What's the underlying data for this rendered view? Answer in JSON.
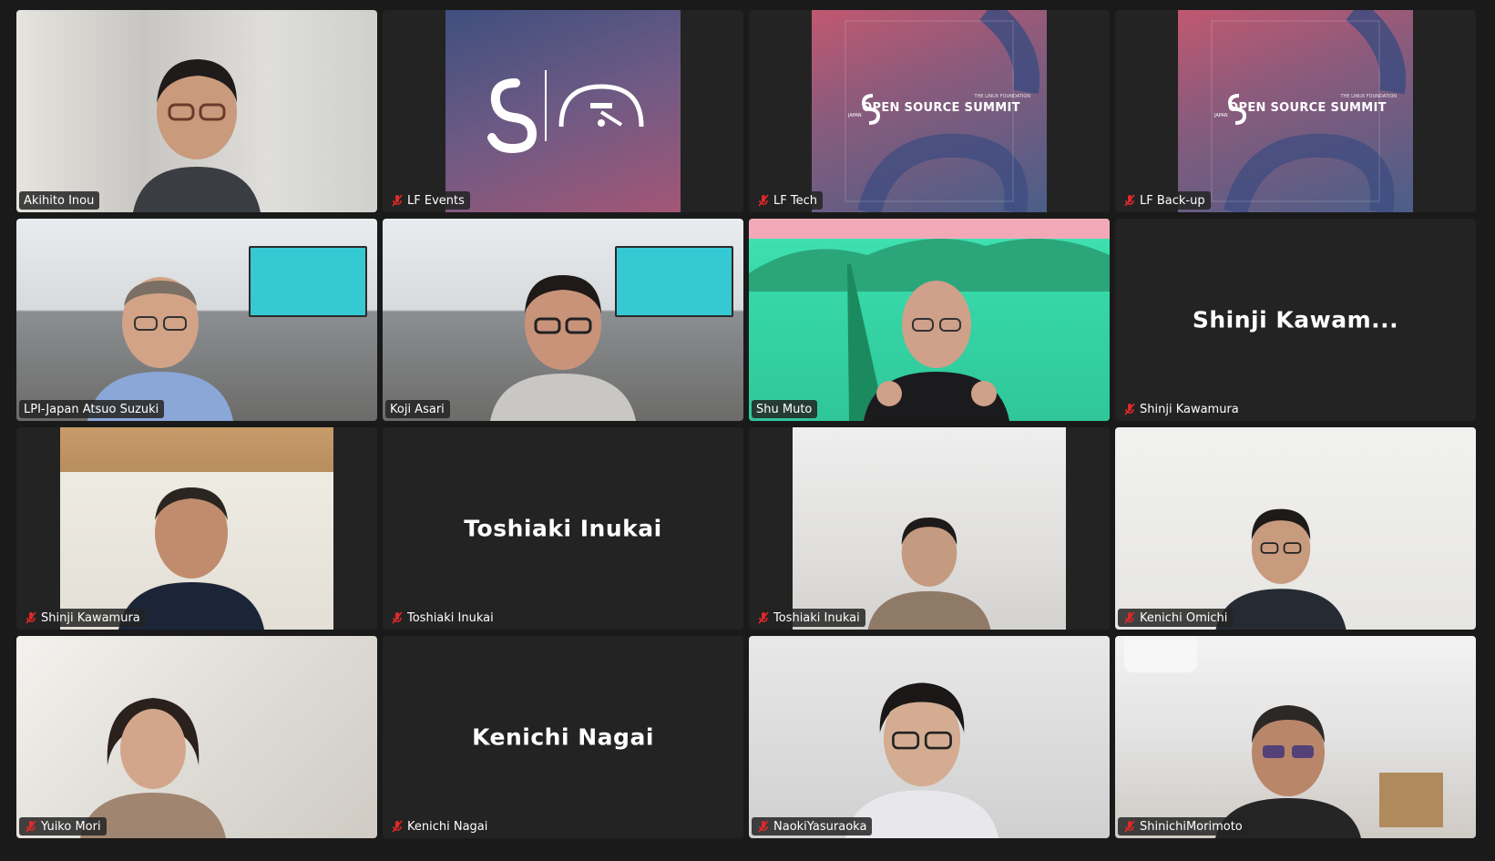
{
  "tiles": [
    {
      "name": "Akihito Inou",
      "muted": false,
      "kind": "video"
    },
    {
      "name": "LF Events",
      "muted": true,
      "kind": "logo"
    },
    {
      "name": "LF Tech",
      "muted": true,
      "kind": "oss"
    },
    {
      "name": "LF Back-up",
      "muted": true,
      "kind": "oss"
    },
    {
      "name": "LPI-Japan Atsuo Suzuki",
      "muted": false,
      "kind": "video"
    },
    {
      "name": "Koji Asari",
      "muted": false,
      "kind": "video"
    },
    {
      "name": "Shu Muto",
      "muted": false,
      "kind": "video",
      "active": true
    },
    {
      "name": "Shinji Kawamura",
      "muted": true,
      "kind": "name-only",
      "display_name": "Shinji Kawam..."
    },
    {
      "name": "Shinji Kawamura",
      "muted": true,
      "kind": "video"
    },
    {
      "name": "Toshiaki Inukai",
      "muted": true,
      "kind": "name-only",
      "display_name": "Toshiaki Inukai"
    },
    {
      "name": "Toshiaki Inukai",
      "muted": true,
      "kind": "video"
    },
    {
      "name": "Kenichi Omichi",
      "muted": true,
      "kind": "video"
    },
    {
      "name": "Yuiko Mori",
      "muted": true,
      "kind": "video"
    },
    {
      "name": "Kenichi Nagai",
      "muted": true,
      "kind": "name-only",
      "display_name": "Kenichi Nagai"
    },
    {
      "name": "NaokiYasuraoka",
      "muted": true,
      "kind": "video"
    },
    {
      "name": "ShinichiMorimoto",
      "muted": true,
      "kind": "video"
    }
  ],
  "oss_branding": {
    "foundation": "THE LINUX FOUNDATION",
    "title": "OPEN SOURCE SUMMIT",
    "region": "JAPAN"
  },
  "colors": {
    "active_speaker_border": "#2ed35f",
    "muted_icon": "#e02828",
    "tile_bg": "#232323",
    "page_bg": "#1a1a1a"
  }
}
